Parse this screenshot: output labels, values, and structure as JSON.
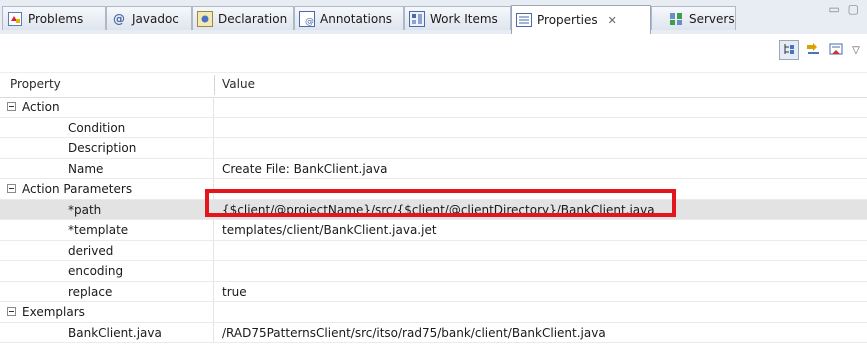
{
  "tabs": [
    {
      "label": "Problems",
      "icon": "problems-icon"
    },
    {
      "label": "Javadoc",
      "icon": "javadoc-icon"
    },
    {
      "label": "Declaration",
      "icon": "declaration-icon"
    },
    {
      "label": "Annotations",
      "icon": "annotations-icon"
    },
    {
      "label": "Work Items",
      "icon": "work-items-icon"
    },
    {
      "label": "Properties",
      "icon": "properties-icon",
      "active": true
    },
    {
      "label": "Servers",
      "icon": "servers-icon"
    }
  ],
  "table": {
    "headers": {
      "property": "Property",
      "value": "Value"
    },
    "rows": [
      {
        "kind": "category",
        "label": "Action"
      },
      {
        "kind": "prop",
        "label": "Condition",
        "value": ""
      },
      {
        "kind": "prop",
        "label": "Description",
        "value": ""
      },
      {
        "kind": "prop",
        "label": "Name",
        "value": "Create File: BankClient.java"
      },
      {
        "kind": "category",
        "label": "Action Parameters"
      },
      {
        "kind": "prop",
        "label": "*path",
        "value": "{$client/@projectName}/src/{$client/@clientDirectory}/BankClient.java",
        "selected": true
      },
      {
        "kind": "prop",
        "label": "*template",
        "value": "templates/client/BankClient.java.jet"
      },
      {
        "kind": "prop",
        "label": "derived",
        "value": ""
      },
      {
        "kind": "prop",
        "label": "encoding",
        "value": ""
      },
      {
        "kind": "prop",
        "label": "replace",
        "value": "true"
      },
      {
        "kind": "category",
        "label": "Exemplars"
      },
      {
        "kind": "prop",
        "label": "BankClient.java",
        "value": "/RAD75PatternsClient/src/itso/rad75/bank/client/BankClient.java"
      }
    ]
  },
  "colors": {
    "highlight": "#e3161d",
    "selected_row": "#e3e3e3"
  }
}
